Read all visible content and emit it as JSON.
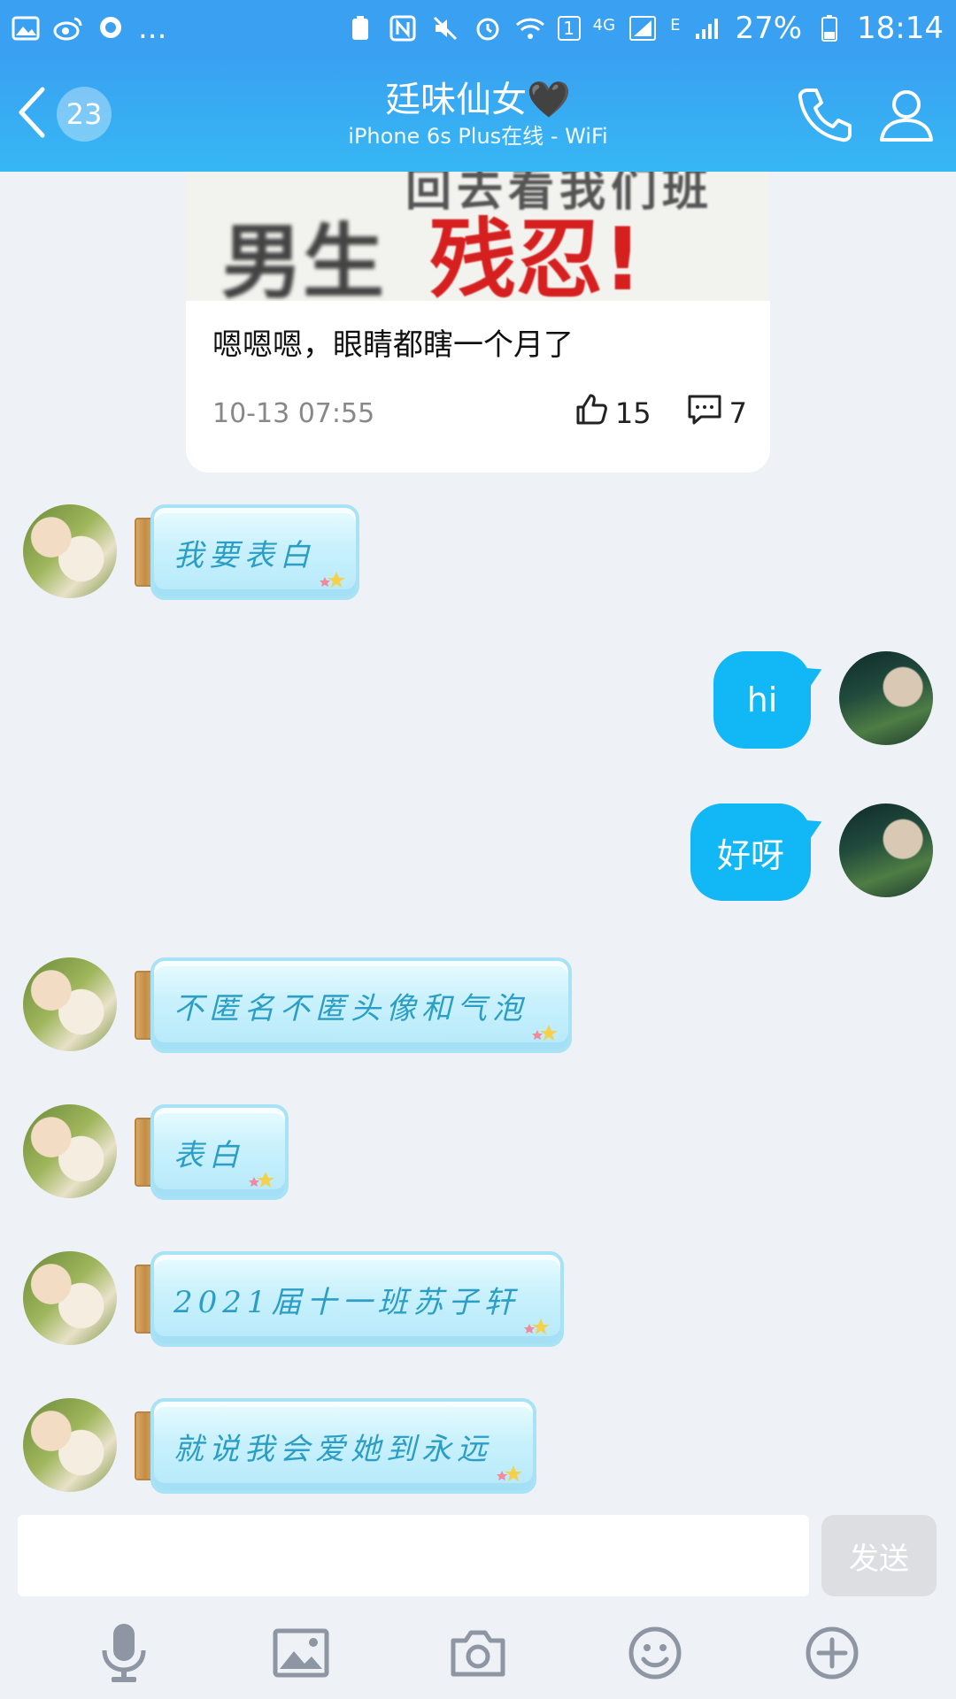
{
  "status_bar": {
    "more": "...",
    "sim_badge": "1",
    "network_4g": "4G",
    "network_e": "E",
    "battery": "27%",
    "time": "18:14"
  },
  "header": {
    "unread_count": "23",
    "title": "廷味仙女🖤",
    "subtitle": "iPhone 6s Plus在线 - WiFi"
  },
  "shared_card": {
    "image_text_top": "回去看我们班",
    "image_text_left": "男生",
    "image_text_right": "残忍!",
    "comment": "嗯嗯嗯，眼睛都瞎一个月了",
    "time": "10-13 07:55",
    "likes": "15",
    "comments": "7"
  },
  "messages": [
    {
      "from": "friend",
      "text": "我要表白"
    },
    {
      "from": "me",
      "text": "hi"
    },
    {
      "from": "me",
      "text": "好呀"
    },
    {
      "from": "friend",
      "text": "不匿名不匿头像和气泡"
    },
    {
      "from": "friend",
      "text": "表白"
    },
    {
      "from": "friend",
      "text": "2021届十一班苏子轩"
    },
    {
      "from": "friend",
      "text": "就说我会爱她到永远"
    }
  ],
  "input": {
    "value": "",
    "send_label": "发送"
  },
  "colors": {
    "header_blue": "#3aa1f2",
    "my_bubble": "#12b7f5",
    "jar_text": "#2c9ec6",
    "background": "#eef1f6"
  },
  "icons": {
    "toolbar": [
      "microphone-icon",
      "image-icon",
      "camera-icon",
      "emoji-icon",
      "plus-icon"
    ]
  }
}
